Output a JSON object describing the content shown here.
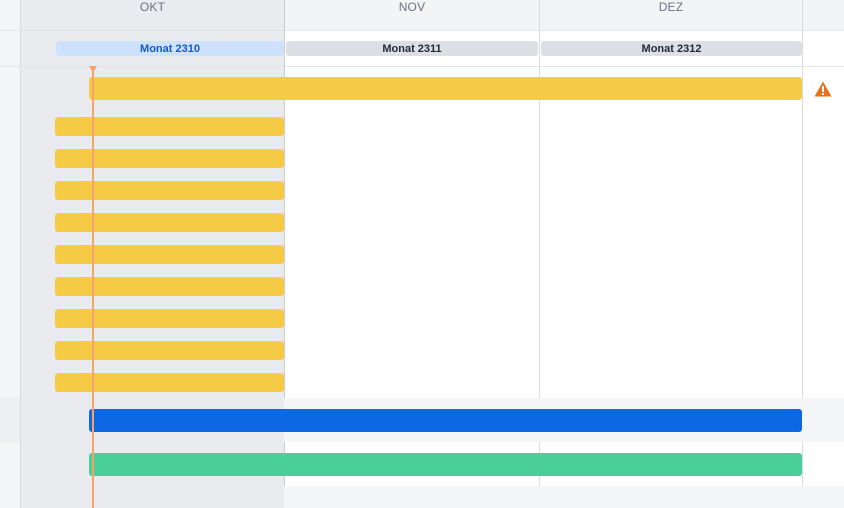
{
  "timeline": {
    "months": [
      {
        "label": "OKT",
        "current": true
      },
      {
        "label": "NOV",
        "current": false
      },
      {
        "label": "DEZ",
        "current": false
      }
    ],
    "sprints": [
      {
        "label": "Monat 2310",
        "active": true
      },
      {
        "label": "Monat 2311",
        "active": false
      },
      {
        "label": "Monat 2312",
        "active": false
      }
    ]
  },
  "icons": {
    "warning": "warning-icon",
    "today_marker": "today-marker-icon"
  },
  "colors": {
    "bar_yellow": "#f5cb45",
    "bar_blue": "#0f68e3",
    "bar_green": "#4acf98",
    "today_line": "#f6a36a",
    "warning": "#e6731c",
    "sprint_active_bg": "#cfe2fd",
    "sprint_active_text": "#0f5bc4",
    "sprint_bg": "#dcdfe4"
  }
}
